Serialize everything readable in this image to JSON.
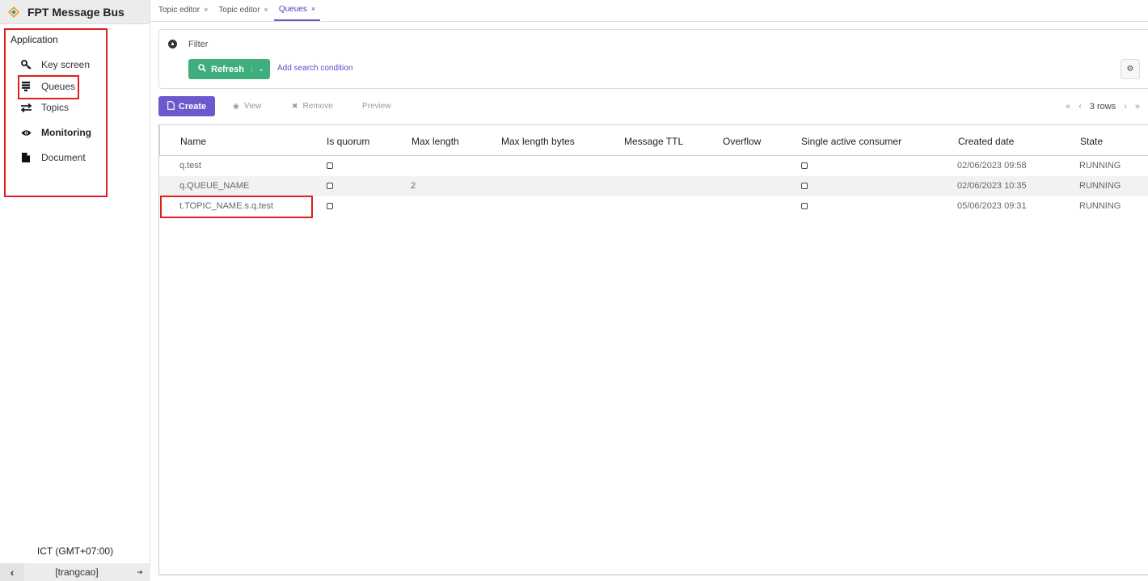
{
  "app": {
    "title": "FPT Message Bus"
  },
  "sidebar": {
    "section_label": "Application",
    "items": [
      {
        "label": "Key screen",
        "icon": "key-icon"
      },
      {
        "label": "Queues",
        "icon": "list-icon"
      },
      {
        "label": "Topics",
        "icon": "exchange-icon"
      },
      {
        "label": "Monitoring",
        "icon": "eye-icon"
      },
      {
        "label": "Document",
        "icon": "file-icon"
      }
    ],
    "timezone": "ICT (GMT+07:00)",
    "user": "[trangcao]"
  },
  "tabs": [
    {
      "label": "Topic editor",
      "close": "×"
    },
    {
      "label": "Topic editor",
      "close": "×"
    },
    {
      "label": "Queues",
      "close": "×",
      "active": true
    }
  ],
  "filter": {
    "label": "Filter",
    "refresh_label": "Refresh",
    "add_condition_label": "Add search condition"
  },
  "toolbar": {
    "create_label": "Create",
    "view_label": "View",
    "remove_label": "Remove",
    "preview_label": "Preview",
    "rows_label": "3 rows"
  },
  "table": {
    "columns": [
      "Name",
      "Is quorum",
      "Max length",
      "Max length bytes",
      "Message TTL",
      "Overflow",
      "Single active consumer",
      "Created date",
      "State"
    ],
    "rows": [
      {
        "name": "q.test",
        "is_quorum": false,
        "max_length": "",
        "max_length_bytes": "",
        "message_ttl": "",
        "overflow": "",
        "single_active_consumer": false,
        "created_date": "02/06/2023 09:58",
        "state": "RUNNING"
      },
      {
        "name": "q.QUEUE_NAME",
        "is_quorum": false,
        "max_length": "2",
        "max_length_bytes": "",
        "message_ttl": "",
        "overflow": "",
        "single_active_consumer": false,
        "created_date": "02/06/2023 10:35",
        "state": "RUNNING"
      },
      {
        "name": "t.TOPIC_NAME.s.q.test",
        "is_quorum": false,
        "max_length": "",
        "max_length_bytes": "",
        "message_ttl": "",
        "overflow": "",
        "single_active_consumer": false,
        "created_date": "05/06/2023 09:31",
        "state": "RUNNING"
      }
    ]
  },
  "colors": {
    "accent": "#6a5acd",
    "refresh": "#3fae7c",
    "highlight": "#e01e1e"
  }
}
